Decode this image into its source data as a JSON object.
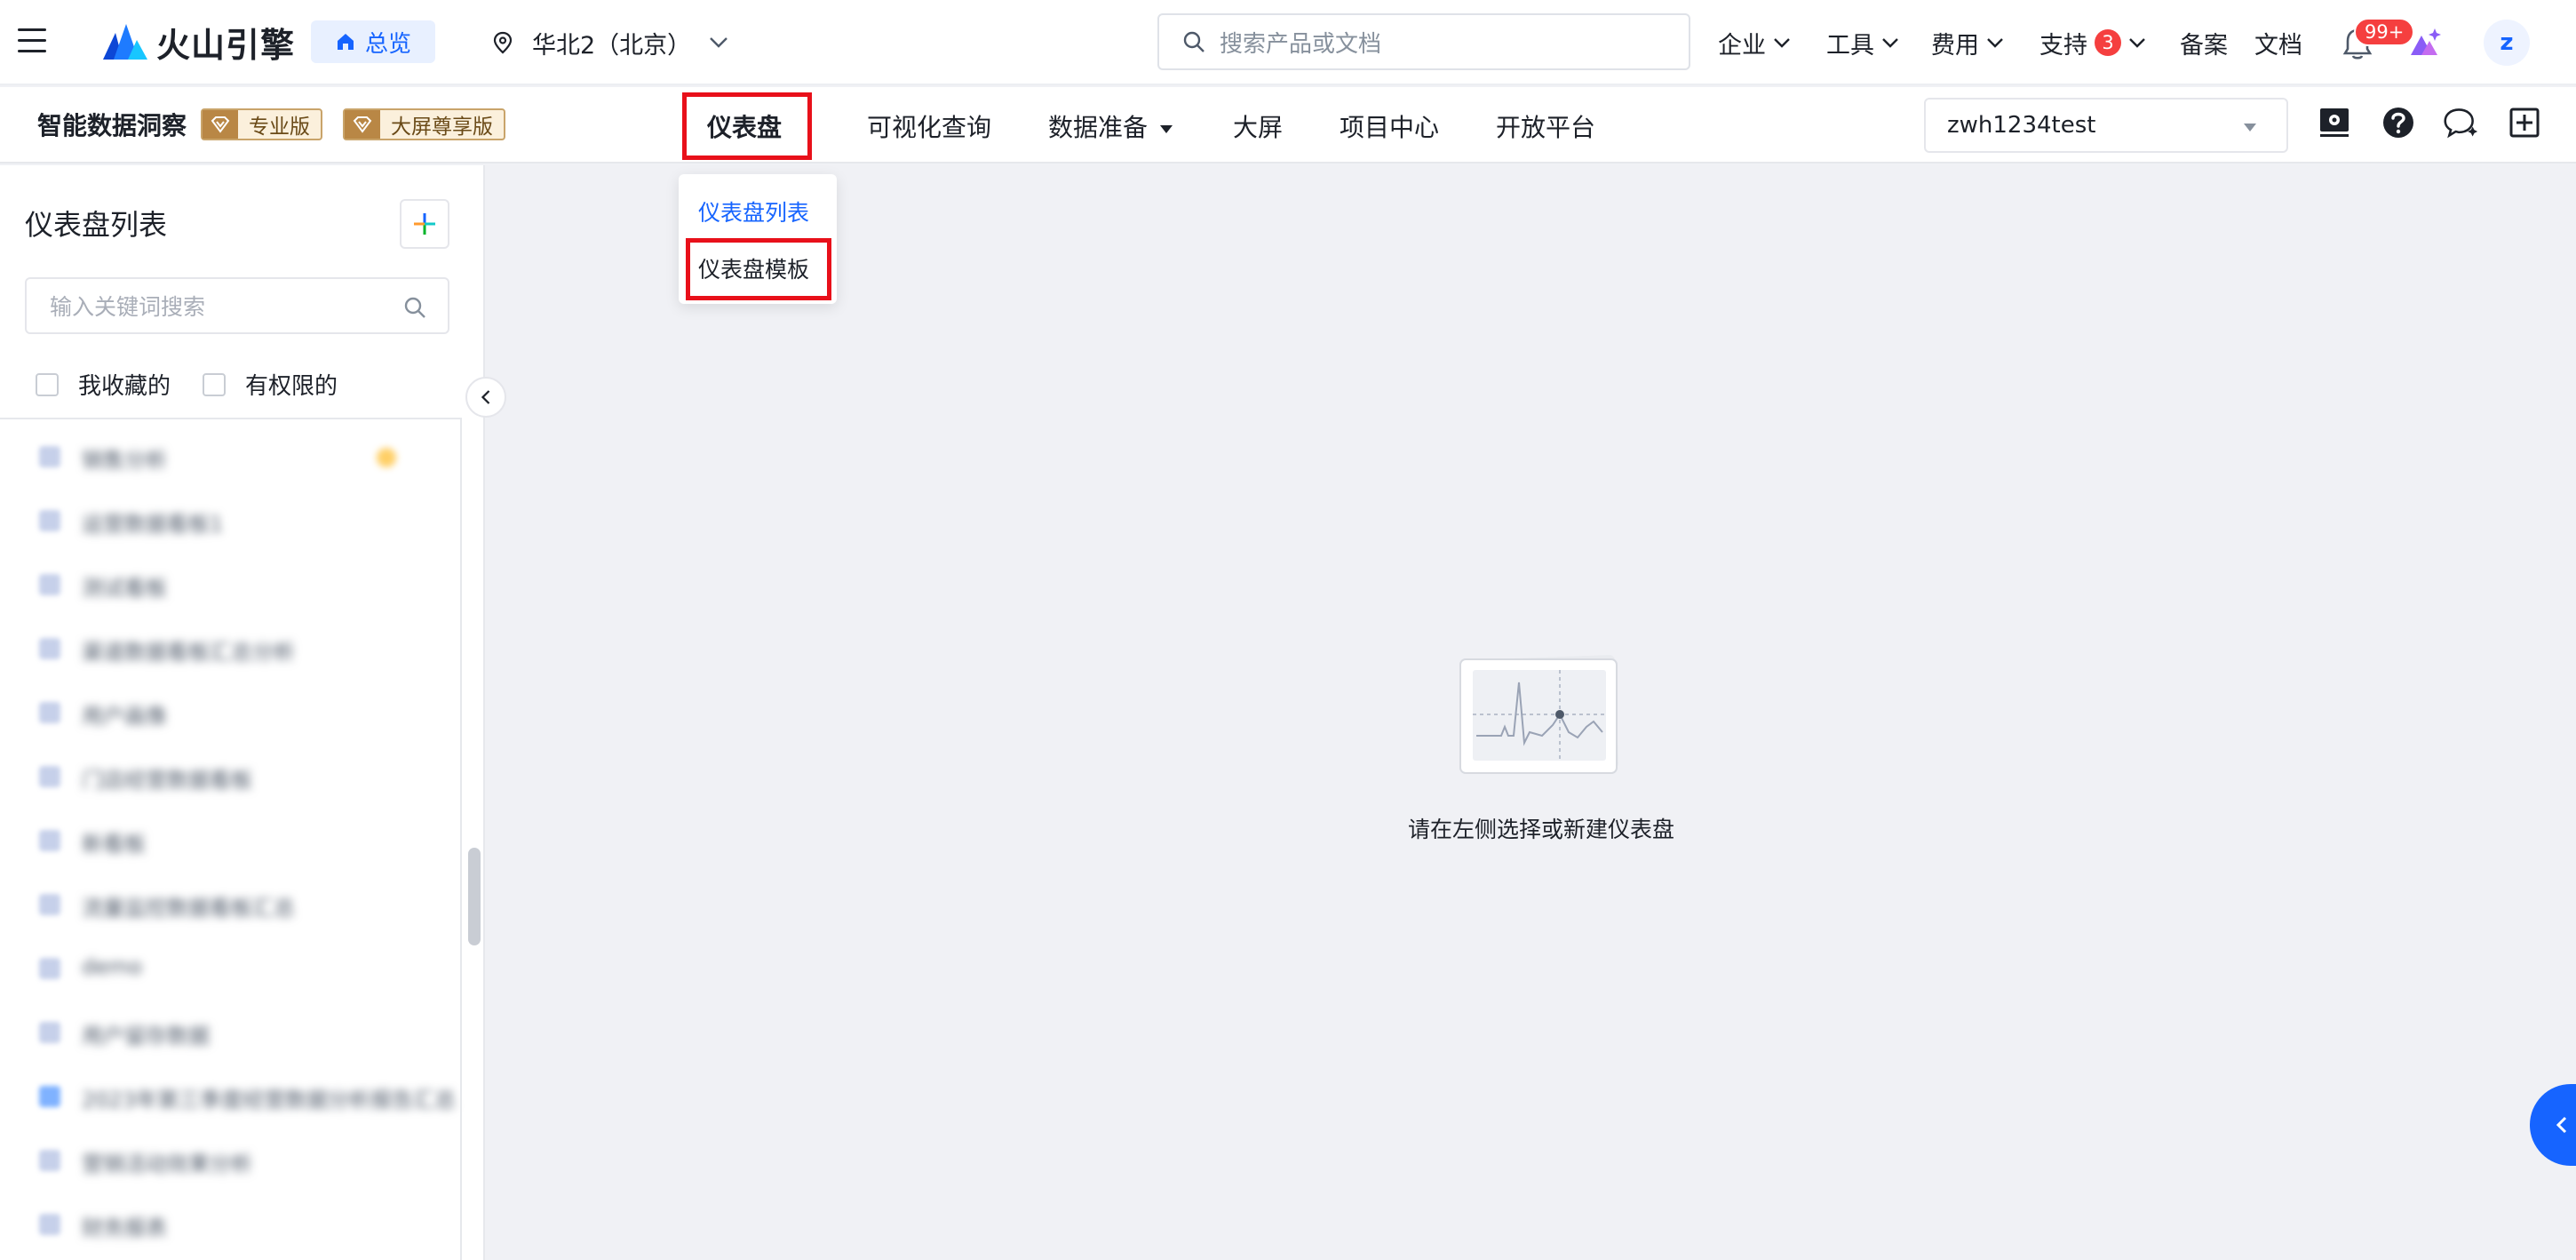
{
  "topbar": {
    "brand": "火山引擎",
    "home_label": "总览",
    "region_label": "华北2（北京）",
    "search_placeholder": "搜索产品或文档",
    "nav": {
      "enterprise": "企业",
      "tools": "工具",
      "billing": "费用",
      "support": "支持",
      "support_badge": "3",
      "filing": "备案",
      "docs": "文档"
    },
    "notification_badge": "99+",
    "avatar_letter": "z"
  },
  "product_bar": {
    "title": "智能数据洞察",
    "edition_pro": "专业版",
    "edition_screen": "大屏尊享版",
    "tabs": {
      "dashboard": "仪表盘",
      "visual_query": "可视化查询",
      "data_prep": "数据准备",
      "big_screen": "大屏",
      "project_center": "项目中心",
      "open_platform": "开放平台"
    },
    "project_name": "zwh1234test"
  },
  "dashboard_menu": {
    "items": [
      "仪表盘列表",
      "仪表盘模板"
    ]
  },
  "sidebar": {
    "title": "仪表盘列表",
    "search_placeholder": "输入关键词搜索",
    "filters": {
      "favorites": "我收藏的",
      "authorized": "有权限的"
    },
    "items": [
      "销售分析",
      "运营数据看板1",
      "测试看板",
      "渠道数据看板汇总分析",
      "用户画像",
      "门店经营数据看板",
      "新看板",
      "流量监控数据看板汇总",
      "demo",
      "用户留存数据",
      "2023年第三季度经营数据分析报告汇总",
      "营销活动效果分析",
      "财务报表"
    ]
  },
  "main": {
    "empty_text": "请在左侧选择或新建仪表盘"
  },
  "colors": {
    "accent": "#1664ff",
    "highlight": "#e8101a",
    "badge": "#f53f3f",
    "edition_gold": "#b98745"
  }
}
